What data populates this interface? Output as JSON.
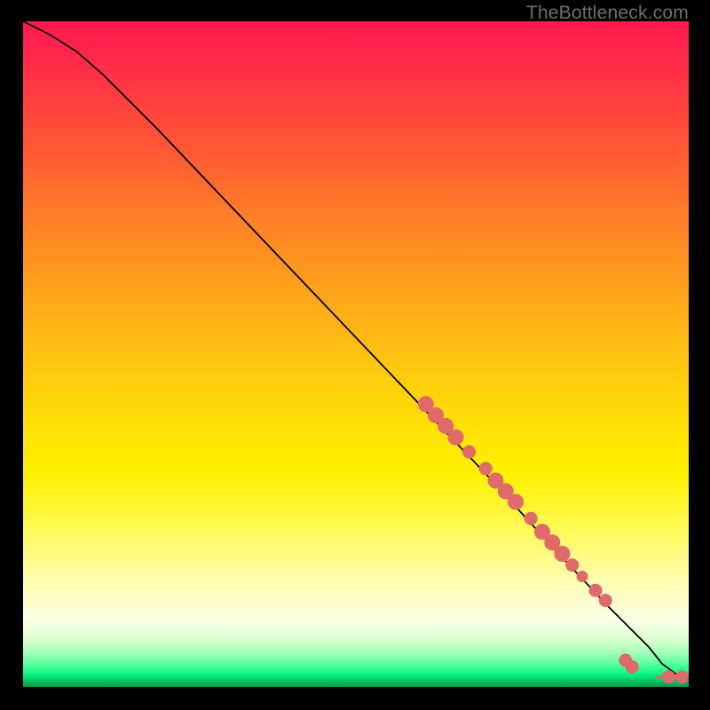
{
  "watermark": "TheBottleneck.com",
  "colors": {
    "dot": "#e06a6a",
    "curve": "#000000",
    "background": "#000000"
  },
  "chart_data": {
    "type": "line",
    "title": "",
    "xlabel": "",
    "ylabel": "",
    "xlim": [
      0,
      100
    ],
    "ylim": [
      0,
      100
    ],
    "grid": false,
    "legend": false,
    "series": [
      {
        "name": "curve",
        "x": [
          0,
          4,
          8,
          12,
          20,
          30,
          40,
          50,
          60,
          70,
          80,
          88,
          92,
          94,
          96,
          98,
          100
        ],
        "y": [
          100,
          98,
          95.5,
          92,
          84,
          73.5,
          63,
          52.5,
          42,
          31.5,
          20.5,
          12,
          8,
          6,
          3.5,
          2,
          1.2
        ]
      }
    ],
    "markers": [
      {
        "x": 60.5,
        "y": 42.5,
        "size": "big"
      },
      {
        "x": 62.0,
        "y": 40.8,
        "size": "big"
      },
      {
        "x": 63.5,
        "y": 39.2,
        "size": "big"
      },
      {
        "x": 65.0,
        "y": 37.5,
        "size": "big"
      },
      {
        "x": 67.0,
        "y": 35.3,
        "size": "mid"
      },
      {
        "x": 69.5,
        "y": 32.8,
        "size": "mid"
      },
      {
        "x": 71.0,
        "y": 31.0,
        "size": "big"
      },
      {
        "x": 72.5,
        "y": 29.4,
        "size": "big"
      },
      {
        "x": 74.0,
        "y": 27.8,
        "size": "big"
      },
      {
        "x": 76.3,
        "y": 25.3,
        "size": "mid"
      },
      {
        "x": 78.0,
        "y": 23.3,
        "size": "big"
      },
      {
        "x": 79.5,
        "y": 21.7,
        "size": "big"
      },
      {
        "x": 81.0,
        "y": 20.0,
        "size": "big"
      },
      {
        "x": 82.5,
        "y": 18.3,
        "size": "mid"
      },
      {
        "x": 84.0,
        "y": 16.6,
        "size": "sm"
      },
      {
        "x": 86.0,
        "y": 14.5,
        "size": "mid"
      },
      {
        "x": 87.5,
        "y": 13.0,
        "size": "mid"
      },
      {
        "x": 90.5,
        "y": 4.0,
        "size": "mid"
      },
      {
        "x": 91.5,
        "y": 3.0,
        "size": "mid"
      },
      {
        "x": 97.0,
        "y": 1.5,
        "size": "mid"
      },
      {
        "x": 99.0,
        "y": 1.5,
        "size": "mid"
      }
    ],
    "tail_segment": {
      "x0": 95.0,
      "y0": 1.5,
      "x1": 99.5,
      "y1": 1.5
    }
  }
}
